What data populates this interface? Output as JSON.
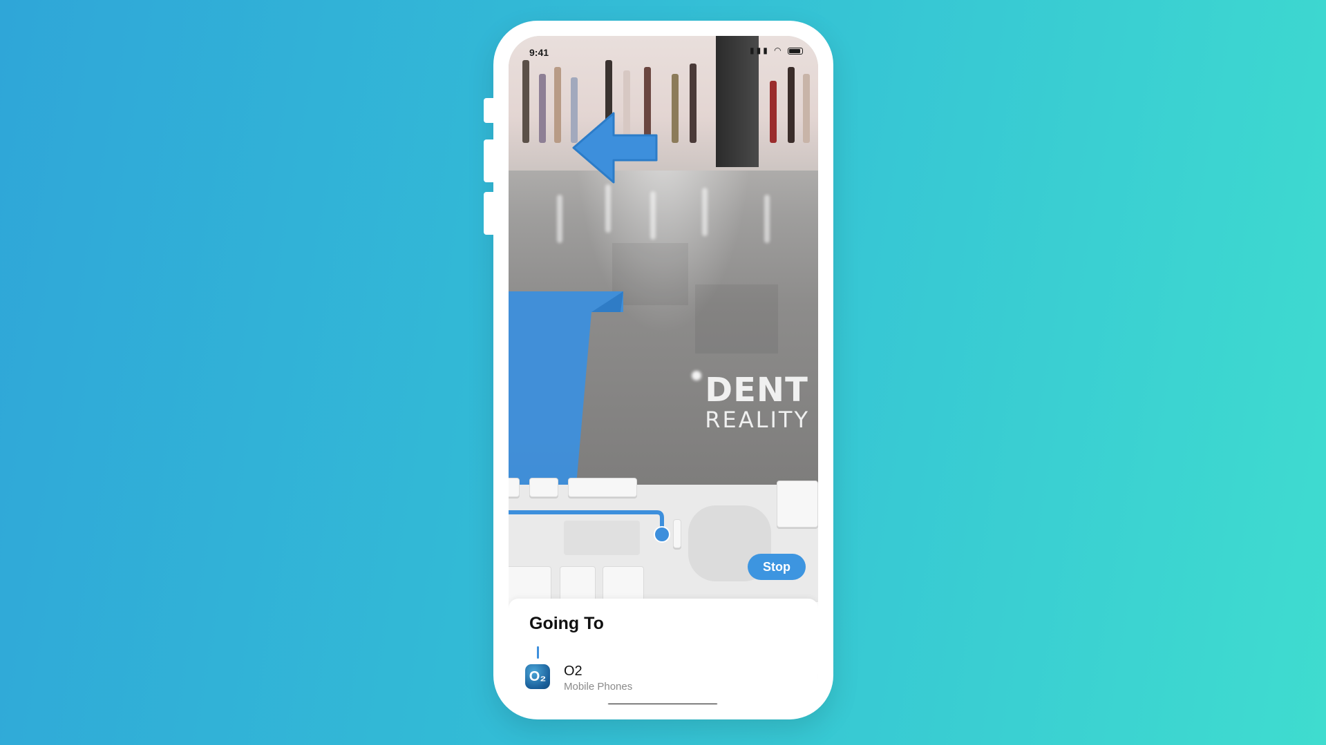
{
  "status_bar": {
    "time": "9:41",
    "location_icon": "location-arrow-icon",
    "signal_icon": "cellular-signal-icon",
    "wifi_icon": "wifi-icon",
    "battery_icon": "battery-icon"
  },
  "ar_view": {
    "direction_icon": "left-arrow-icon",
    "watermark_line1": "DENT",
    "watermark_line2": "REALITY",
    "accent_color": "#3d8fdc"
  },
  "map": {
    "stop_label": "Stop"
  },
  "going_to": {
    "title": "Going To",
    "destination": {
      "icon_text": "O₂",
      "name": "O2",
      "category": "Mobile Phones"
    }
  }
}
